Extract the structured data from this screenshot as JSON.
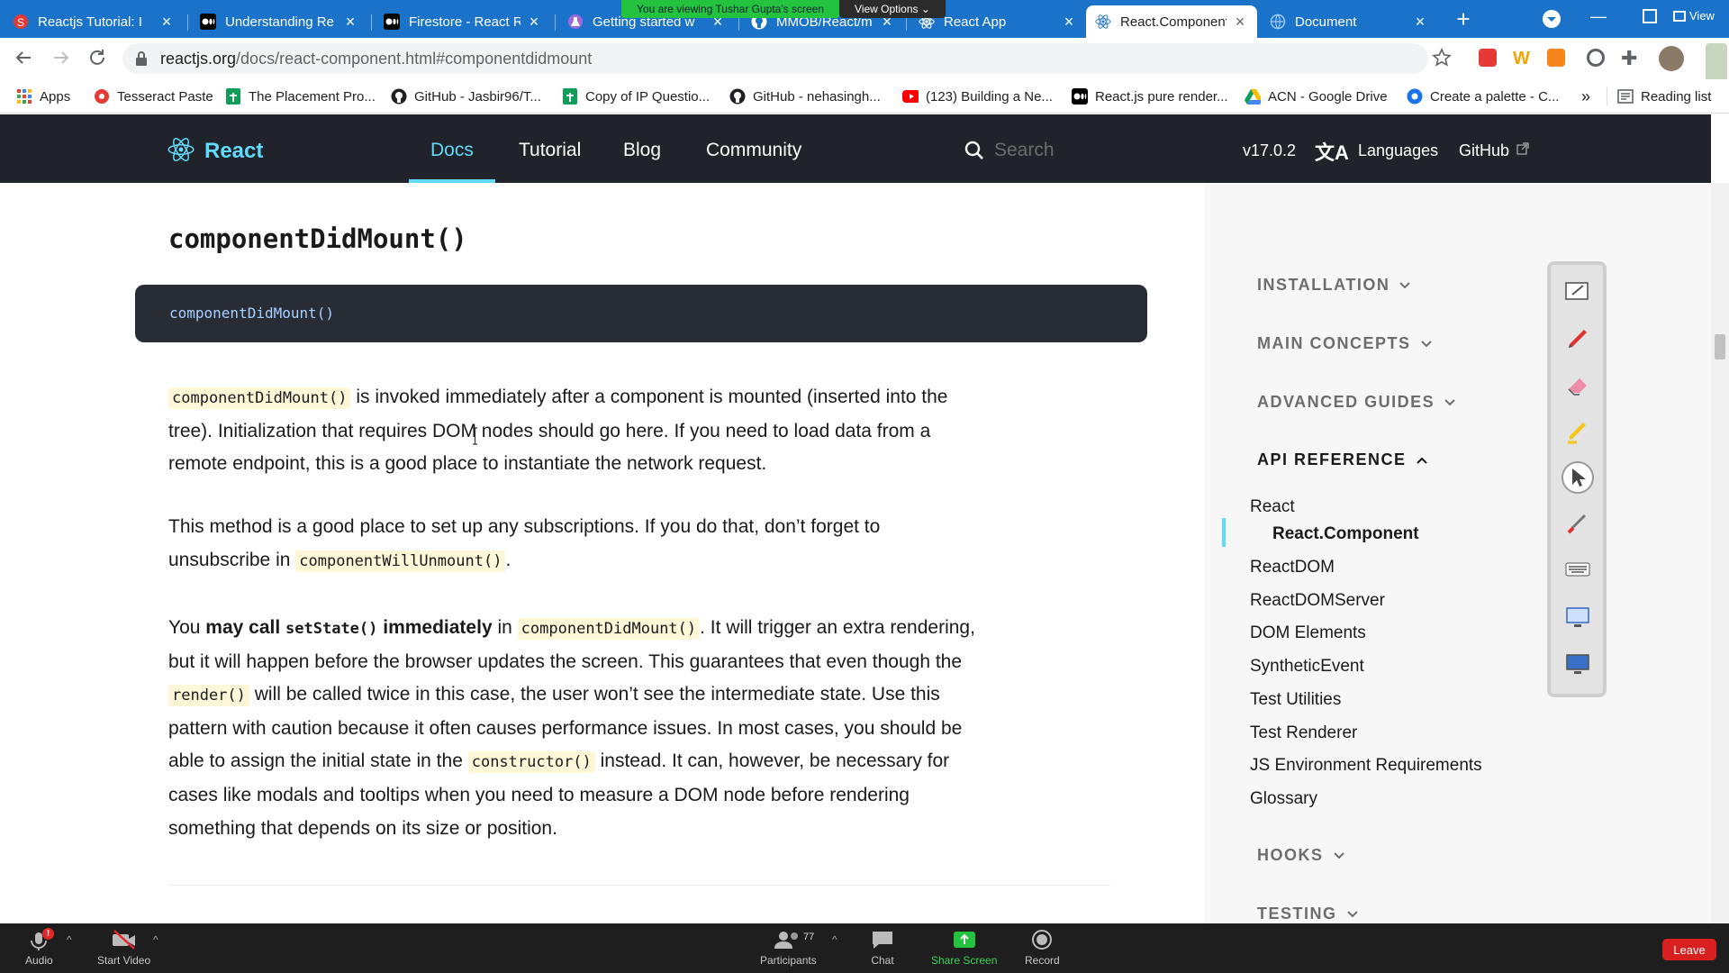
{
  "tabs": [
    {
      "title": "Reactjs Tutorial: I",
      "favicon": "shield-s-icon"
    },
    {
      "title": "Understanding Re",
      "favicon": "medium-icon"
    },
    {
      "title": "Firestore - React R",
      "favicon": "medium-icon"
    },
    {
      "title": "Getting started w",
      "favicon": "flask-icon"
    },
    {
      "title": "MMOB/React/m",
      "favicon": "github-icon"
    },
    {
      "title": "React App",
      "favicon": "react-icon"
    },
    {
      "title": "React.Component",
      "favicon": "react-icon"
    },
    {
      "title": "Document",
      "favicon": "globe-icon"
    }
  ],
  "share_banner": {
    "text": "You are viewing Tushar Gupta's screen",
    "view_options": "View Options"
  },
  "window": {
    "view_label": "View"
  },
  "address": {
    "domain": "reactjs.org",
    "path": "/docs/react-component.html#componentdidmount"
  },
  "bookmarks": [
    {
      "label": "Apps",
      "icon": "apps-grid-icon"
    },
    {
      "label": "Tesseract Paste",
      "icon": "tesseract-icon"
    },
    {
      "label": "The Placement Pro...",
      "icon": "sheets-icon"
    },
    {
      "label": "GitHub - Jasbir96/T...",
      "icon": "github-icon"
    },
    {
      "label": "Copy of IP Questio...",
      "icon": "sheets-icon"
    },
    {
      "label": "GitHub - nehasingh...",
      "icon": "github-icon"
    },
    {
      "label": "(123) Building a Ne...",
      "icon": "youtube-icon"
    },
    {
      "label": "React.js pure render...",
      "icon": "medium-icon"
    },
    {
      "label": "ACN - Google Drive",
      "icon": "drive-icon"
    },
    {
      "label": "Create a palette - C...",
      "icon": "chrome-icon"
    }
  ],
  "bookmarks_more": "»",
  "reading_list": "Reading list",
  "header": {
    "logo": "React",
    "nav": [
      "Docs",
      "Tutorial",
      "Blog",
      "Community"
    ],
    "search_placeholder": "Search",
    "version": "v17.0.2",
    "languages": "Languages",
    "github": "GitHub"
  },
  "article": {
    "heading": "componentDidMount()",
    "code": "componentDidMount()",
    "p1": {
      "code": "componentDidMount()",
      "text": "is invoked immediately after a component is mounted (inserted into the tree). Initialization that requires DOM nodes should go here. If you need to load data from a remote endpoint, this is a good place to instantiate the network request."
    },
    "p2": {
      "text": "This method is a good place to set up any subscriptions. If you do that, don’t forget to unsubscribe in",
      "code": "componentWillUnmount()",
      "end": "."
    },
    "p3": {
      "you": "You",
      "bold1": "may call",
      "code_setstate": "setState()",
      "bold2": "immediately",
      "in": "in",
      "code_cdm": "componentDidMount()",
      "t1": ". It will trigger an extra rendering, but it will happen before the browser updates the screen. This guarantees that even though the",
      "code_render": "render()",
      "t2": "will be called twice in this case, the user won’t see the intermediate state. Use this pattern with caution because it often causes performance issues. In most cases, you should be able to assign the initial state in the",
      "code_constructor": "constructor()",
      "t3": "instead. It can, however, be necessary for cases like modals and tooltips when you need to measure a DOM node before rendering something that depends on its size or position."
    }
  },
  "sidebar": {
    "sections": [
      "INSTALLATION",
      "MAIN CONCEPTS",
      "ADVANCED GUIDES",
      "API REFERENCE",
      "HOOKS",
      "TESTING"
    ],
    "api_items": [
      "React",
      "React.Component",
      "ReactDOM",
      "ReactDOMServer",
      "DOM Elements",
      "SyntheticEvent",
      "Test Utilities",
      "Test Renderer",
      "JS Environment Requirements",
      "Glossary"
    ]
  },
  "meeting": {
    "audio": "Audio",
    "audio_badge": "!",
    "video": "Start Video",
    "participants": "Participants",
    "participants_count": "77",
    "chat": "Chat",
    "share": "Share Screen",
    "record": "Record",
    "leave": "Leave"
  },
  "colors": {
    "accent": "#61dafb",
    "header_bg": "#20232a",
    "chrome_blue": "#1a73c9",
    "zoom_green": "#23c23f",
    "leave_red": "#d92020"
  }
}
